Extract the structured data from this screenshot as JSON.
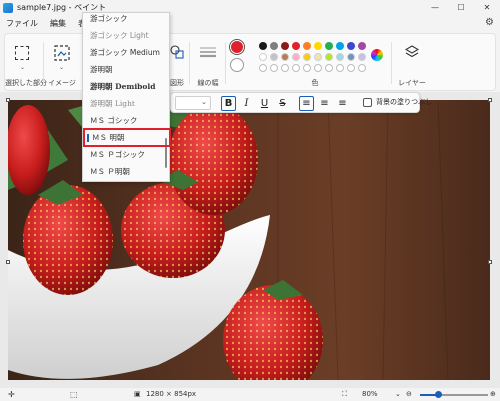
{
  "window": {
    "title": "sample7.jpg - ペイント",
    "minimize": "—",
    "maximize": "☐",
    "close": "✕"
  },
  "menu": {
    "items": [
      "ファイル",
      "編集",
      "表示"
    ],
    "settings_icon": "gear-icon"
  },
  "ribbon": {
    "selection_label": "選択した部分",
    "image_label": "イメージ",
    "shapes_label": "図形",
    "size_label": "線の幅",
    "colors_label": "色",
    "layers_label": "レイヤー",
    "primary_color": "#e0202a",
    "secondary_color": "#ffffff",
    "palette_row1": [
      "#1a1a1a",
      "#7f7f7f",
      "#8b1a1a",
      "#e0202a",
      "#ff7f27",
      "#ffd800",
      "#22b14c",
      "#00a2e8",
      "#3f48cc",
      "#a349a4"
    ],
    "palette_row2": [
      "#ffffff",
      "#c3c3c3",
      "#b97a57",
      "#ffaec9",
      "#ffc90e",
      "#efe4b0",
      "#b5e61d",
      "#99d9ea",
      "#7092be",
      "#c8bfe7"
    ]
  },
  "font_dropdown": {
    "items": [
      {
        "label": "游ゴシック",
        "style": "normal"
      },
      {
        "label": "游ゴシック Light",
        "style": "light"
      },
      {
        "label": "游ゴシック Medium",
        "style": "normal"
      },
      {
        "label": "游明朝",
        "style": "serif"
      },
      {
        "label": "游明朝 Demibold",
        "style": "serif-bold"
      },
      {
        "label": "游明朝 Light",
        "style": "serif-light"
      },
      {
        "label": "ＭＳ ゴシック",
        "style": "normal"
      },
      {
        "label": "ＭＳ 明朝",
        "style": "serif-selected"
      },
      {
        "label": "ＭＳ Ｐゴシック",
        "style": "normal"
      },
      {
        "label": "ＭＳ Ｐ明朝",
        "style": "serif"
      }
    ]
  },
  "text_toolbar": {
    "bold": "B",
    "italic": "I",
    "underline": "U",
    "strikethrough": "S",
    "align_left": "≡",
    "align_center": "≡",
    "align_right": "≡",
    "fill_background_label": "背景の塗りつぶし"
  },
  "status": {
    "dimensions": "1280 × 854px",
    "zoom": "80%",
    "zoom_fraction": 0.27
  }
}
